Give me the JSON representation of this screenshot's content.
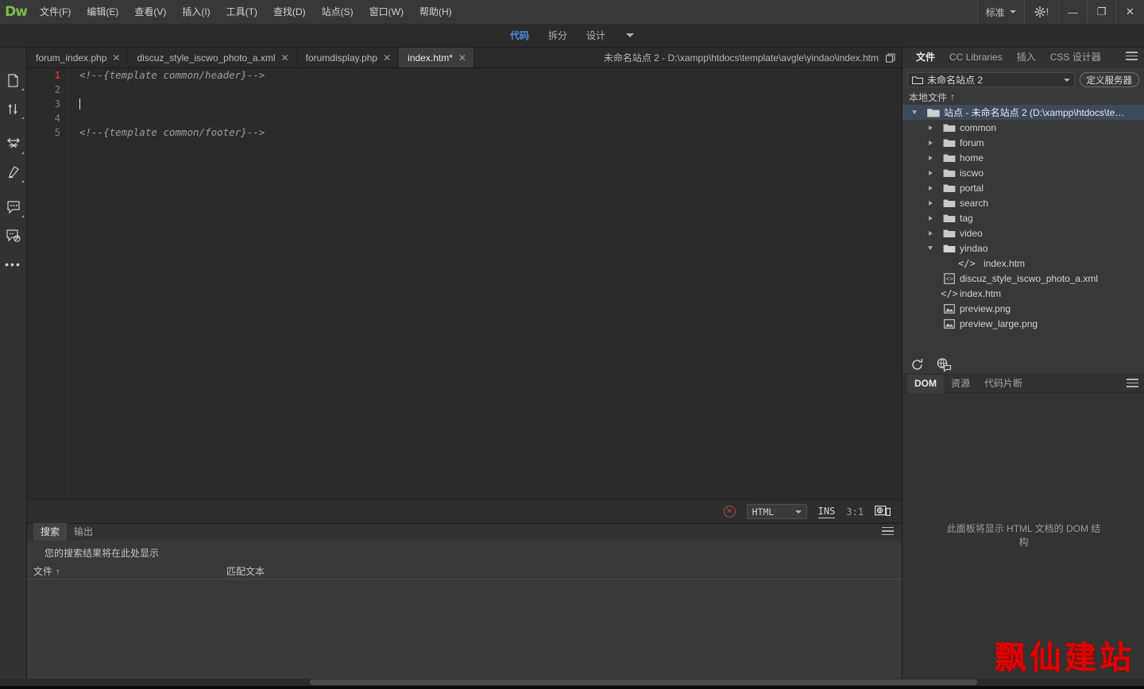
{
  "app": {
    "logo": "Dw",
    "menu": [
      "文件(F)",
      "编辑(E)",
      "查看(V)",
      "插入(I)",
      "工具(T)",
      "查找(D)",
      "站点(S)",
      "窗口(W)",
      "帮助(H)"
    ],
    "workspace": "标准",
    "gear_badge": "!",
    "window_buttons": {
      "minimize": "—",
      "maximize": "❐",
      "close": "✕"
    }
  },
  "viewbar": {
    "modes": [
      "代码",
      "拆分",
      "设计"
    ],
    "active": "代码"
  },
  "left_toolbar": {
    "icons": [
      "open-documents-icon",
      "source-navigator-icon",
      "collapse-expand-icon",
      "format-source-code-icon",
      "apply-comment-icon",
      "remove-comment-icon"
    ],
    "more": "•••"
  },
  "doc_tabs": [
    {
      "label": "forum_index.php",
      "active": false,
      "close": "✕"
    },
    {
      "label": "discuz_style_iscwo_photo_a.xml",
      "active": false,
      "close": "✕"
    },
    {
      "label": "forumdisplay.php",
      "active": false,
      "close": "✕"
    },
    {
      "label": "index.htm*",
      "active": true,
      "close": "✕"
    }
  ],
  "doc_path": "未命名站点 2 - D:\\xampp\\htdocs\\template\\avgle\\yindao\\index.htm",
  "editor": {
    "lines": [
      {
        "num": "1",
        "text": "<!--{template common/header}-->",
        "current": true
      },
      {
        "num": "2",
        "text": "",
        "current": false
      },
      {
        "num": "3",
        "text": "",
        "current": false,
        "caret": true
      },
      {
        "num": "4",
        "text": "",
        "current": false
      },
      {
        "num": "5",
        "text": "<!--{template common/footer}-->",
        "current": false
      }
    ]
  },
  "editor_status": {
    "error_icon": "✕",
    "language": "HTML",
    "insert_mode": "INS",
    "cursor_position": "3:1",
    "preview_icon": "realtime-preview-icon"
  },
  "search_panel": {
    "tabs": [
      "搜索",
      "输出"
    ],
    "active_tab": "搜索",
    "empty_message": "您的搜索结果将在此处显示",
    "columns": [
      "文件",
      "匹配文本"
    ],
    "sort_arrow": "↑"
  },
  "right_panel": {
    "tabs": [
      "文件",
      "CC Libraries",
      "插入",
      "CSS 设计器"
    ],
    "active_tab": "文件",
    "site_name": "未命名站点 2",
    "define_server_button": "定义服务器",
    "local_files_header": "本地文件",
    "local_files_arrow": "↑",
    "tree": [
      {
        "label": "站点 - 未命名站点 2 (D:\\xampp\\htdocs\\templa...",
        "icon": "folder-open-icon",
        "state": "expanded",
        "indent": 0,
        "selected": true
      },
      {
        "label": "common",
        "icon": "folder-icon",
        "state": "collapsed",
        "indent": 1,
        "selected": false
      },
      {
        "label": "forum",
        "icon": "folder-icon",
        "state": "collapsed",
        "indent": 1,
        "selected": false
      },
      {
        "label": "home",
        "icon": "folder-icon",
        "state": "collapsed",
        "indent": 1,
        "selected": false
      },
      {
        "label": "iscwo",
        "icon": "folder-icon",
        "state": "collapsed",
        "indent": 1,
        "selected": false
      },
      {
        "label": "portal",
        "icon": "folder-icon",
        "state": "collapsed",
        "indent": 1,
        "selected": false
      },
      {
        "label": "search",
        "icon": "folder-icon",
        "state": "collapsed",
        "indent": 1,
        "selected": false
      },
      {
        "label": "tag",
        "icon": "folder-icon",
        "state": "collapsed",
        "indent": 1,
        "selected": false
      },
      {
        "label": "video",
        "icon": "folder-icon",
        "state": "collapsed",
        "indent": 1,
        "selected": false
      },
      {
        "label": "yindao",
        "icon": "folder-open-icon",
        "state": "expanded",
        "indent": 1,
        "selected": false
      },
      {
        "label": "index.htm",
        "icon": "html-file-icon",
        "state": "leaf",
        "indent": 2,
        "selected": false
      },
      {
        "label": "discuz_style_iscwo_photo_a.xml",
        "icon": "xml-file-icon",
        "state": "leaf",
        "indent": 1,
        "selected": false
      },
      {
        "label": "index.htm",
        "icon": "html-file-icon",
        "state": "leaf",
        "indent": 1,
        "selected": false
      },
      {
        "label": "preview.png",
        "icon": "image-file-icon",
        "state": "leaf",
        "indent": 1,
        "selected": false
      },
      {
        "label": "preview_large.png",
        "icon": "image-file-icon",
        "state": "leaf",
        "indent": 1,
        "selected": false
      }
    ],
    "buttons": [
      "refresh-icon",
      "sync-icon"
    ]
  },
  "dom_panel": {
    "tabs": [
      "DOM",
      "资源",
      "代码片断"
    ],
    "active_tab": "DOM",
    "message": "此面板将显示 HTML 文档的 DOM 结构"
  },
  "watermark": "飘仙建站",
  "colors": {
    "accent_blue": "#4a90e2",
    "selection_blue": "#3c4a5c",
    "error_red": "#b04a4a",
    "line_number_red": "#d0302f",
    "watermark_red": "#e00000",
    "logo_green": "#7bbf4a",
    "chrome_bg": "#383838",
    "editor_bg": "#2b2b2b"
  }
}
